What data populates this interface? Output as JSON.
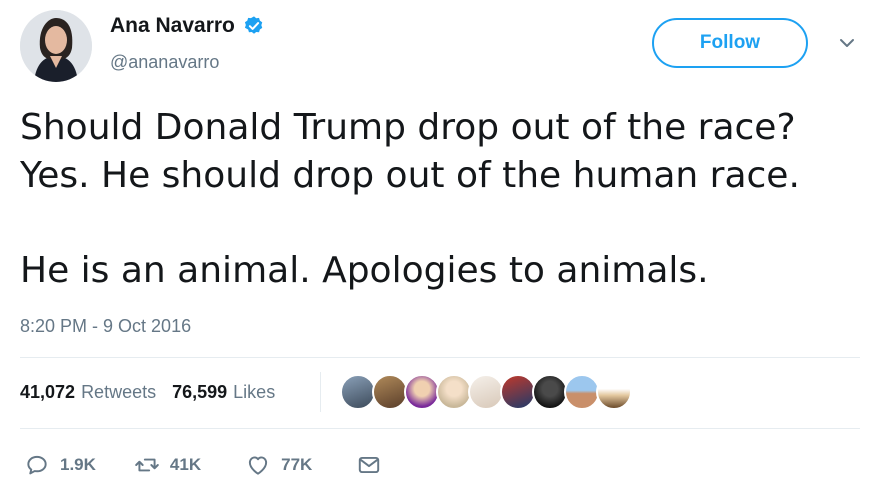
{
  "author": {
    "display_name": "Ana Navarro",
    "handle": "@ananavarro",
    "verified": true
  },
  "follow_button_label": "Follow",
  "tweet": {
    "lines": [
      "Should Donald Trump drop out of the race?",
      "Yes. He should drop out of the human race.",
      "He is an animal. Apologies to animals."
    ],
    "timestamp": "8:20 PM - 9 Oct 2016"
  },
  "stats": {
    "retweets_count": "41,072",
    "retweets_label": "Retweets",
    "likes_count": "76,599",
    "likes_label": "Likes"
  },
  "actions": {
    "reply_count": "1.9K",
    "retweet_count": "41K",
    "like_count": "77K"
  },
  "colors": {
    "accent": "#1da1f2",
    "muted": "#657786",
    "text": "#14171a"
  }
}
